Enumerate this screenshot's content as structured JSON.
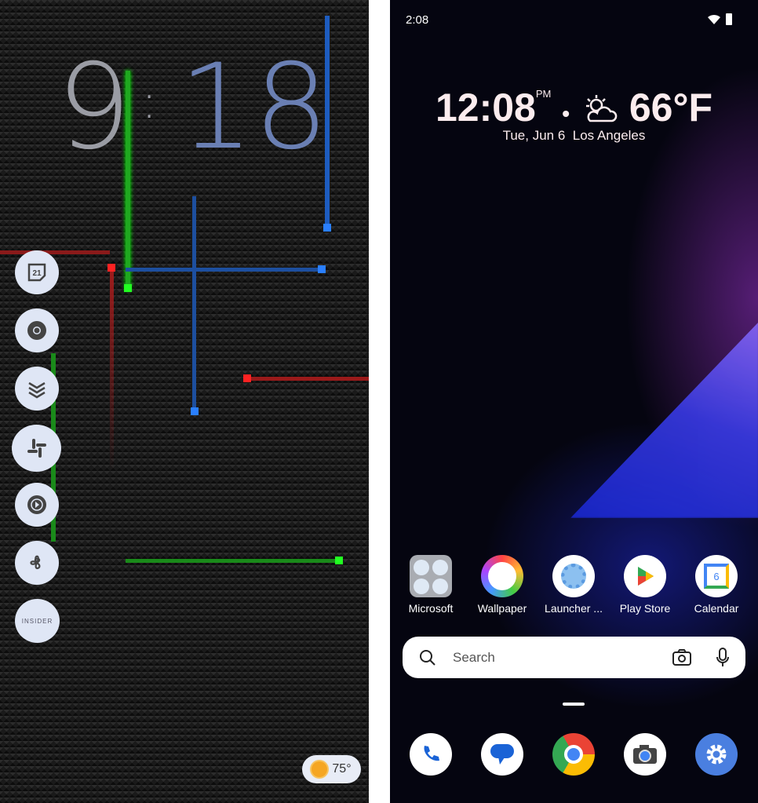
{
  "left_screen": {
    "clock": {
      "hour": "9",
      "separator": ":",
      "minute": "18"
    },
    "side_apps": [
      {
        "name": "calendar",
        "label": "21"
      },
      {
        "name": "chrome"
      },
      {
        "name": "todoist"
      },
      {
        "name": "slack"
      },
      {
        "name": "youtube-music"
      },
      {
        "name": "pinwheel"
      },
      {
        "name": "insider",
        "label": "INSIDER"
      }
    ],
    "weather": {
      "icon": "sun-icon",
      "temp": "75°"
    }
  },
  "right_screen": {
    "status_bar": {
      "time": "2:08",
      "icons": [
        "wifi-icon",
        "battery-icon"
      ]
    },
    "widget": {
      "time": "12:08",
      "ampm": "PM",
      "dot": "•",
      "weather_icon": "partly-cloudy-icon",
      "temp": "66°F",
      "date": "Tue, Jun 6",
      "location": "Los Angeles"
    },
    "apps": [
      {
        "label": "Microsoft",
        "icon": "folder-icon"
      },
      {
        "label": "Wallpaper",
        "icon": "wallpaper-icon"
      },
      {
        "label": "Launcher ...",
        "icon": "launcher-icon"
      },
      {
        "label": "Play Store",
        "icon": "play-store-icon"
      },
      {
        "label": "Calendar",
        "icon": "calendar-icon",
        "badge": "6"
      }
    ],
    "search": {
      "placeholder": "Search"
    },
    "dock": [
      "phone",
      "messages",
      "chrome",
      "camera",
      "settings"
    ],
    "colors": {
      "accent": "#4a7fe0",
      "widget_text": "#fbecee"
    }
  }
}
